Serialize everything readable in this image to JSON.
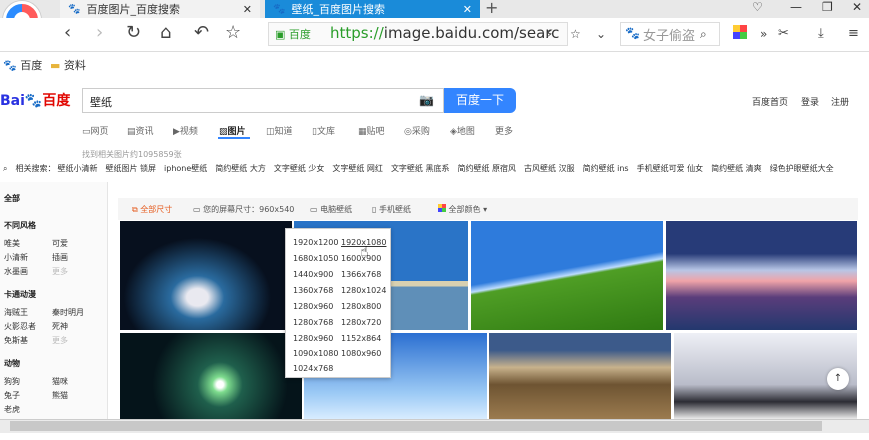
{
  "tabs": [
    {
      "title": "百度图片_百度搜索",
      "active": false
    },
    {
      "title": "壁纸_百度图片搜索",
      "active": true
    }
  ],
  "nav": {
    "url_scheme": "https://",
    "url_rest": "image.baidu.com/searc",
    "trust_label": "百度",
    "search_placeholder": "女子偷盗"
  },
  "bookmarks": [
    "百度",
    "资料"
  ],
  "baidu": {
    "logo_bai": "Bai",
    "logo_du": "百度",
    "query": "壁纸",
    "search_button": "百度一下",
    "top_links": [
      "百度首页",
      "登录",
      "注册"
    ],
    "categories": [
      "网页",
      "资讯",
      "视频",
      "图片",
      "知道",
      "文库",
      "贴吧",
      "采购",
      "地图",
      "更多"
    ],
    "active_category": "图片",
    "result_count": "找到相关图片约1095859张"
  },
  "related": {
    "label": "相关搜索：",
    "items": [
      "壁纸小清新",
      "壁纸图片 锁屏",
      "iphone壁纸",
      "简约壁纸 大方",
      "文字壁纸 少女",
      "文字壁纸 网红",
      "文字壁纸 黑底系",
      "简约壁纸 原宿风",
      "古风壁纸 汉服",
      "简约壁纸 ins",
      "手机壁纸可爱 仙女",
      "简约壁纸 清爽",
      "绿色护眼壁纸大全"
    ]
  },
  "left_filter": {
    "all": "全部",
    "groups": [
      {
        "title": "不同风格",
        "rows": [
          [
            "唯美",
            "可爱"
          ],
          [
            "小清新",
            "插画"
          ],
          [
            "水墨画",
            "更多"
          ]
        ]
      },
      {
        "title": "卡通动漫",
        "rows": [
          [
            "海贼王",
            "秦时明月"
          ],
          [
            "火影忍者",
            "死神"
          ],
          [
            "免斯基",
            "更多"
          ]
        ]
      },
      {
        "title": "动物",
        "rows": [
          [
            "狗狗",
            "猫咪"
          ],
          [
            "兔子",
            "熊猫"
          ],
          [
            "老虎",
            ""
          ]
        ]
      }
    ]
  },
  "filter_bar": {
    "all_sizes": "全部尺寸",
    "screen_size": "您的屏幕尺寸：960x540",
    "computer": "电脑壁纸",
    "phone": "手机壁纸",
    "all_colors": "全部颜色"
  },
  "dropdown": {
    "options": [
      [
        "1920x1200",
        "1920x1080"
      ],
      [
        "1680x1050",
        "1600x900"
      ],
      [
        "1440x900",
        "1366x768"
      ],
      [
        "1360x768",
        "1280x1024"
      ],
      [
        "1280x960",
        "1280x800"
      ],
      [
        "1280x768",
        "1280x720"
      ],
      [
        "1280x960",
        "1152x864"
      ],
      [
        "1090x1080",
        "1080x960"
      ],
      [
        "1024x768",
        ""
      ]
    ]
  },
  "colors": {
    "tab_active": "#1a8bd9",
    "baidu_blue": "#3385ff",
    "baidu_red": "#e10601",
    "filter_active": "#e55b1e"
  }
}
